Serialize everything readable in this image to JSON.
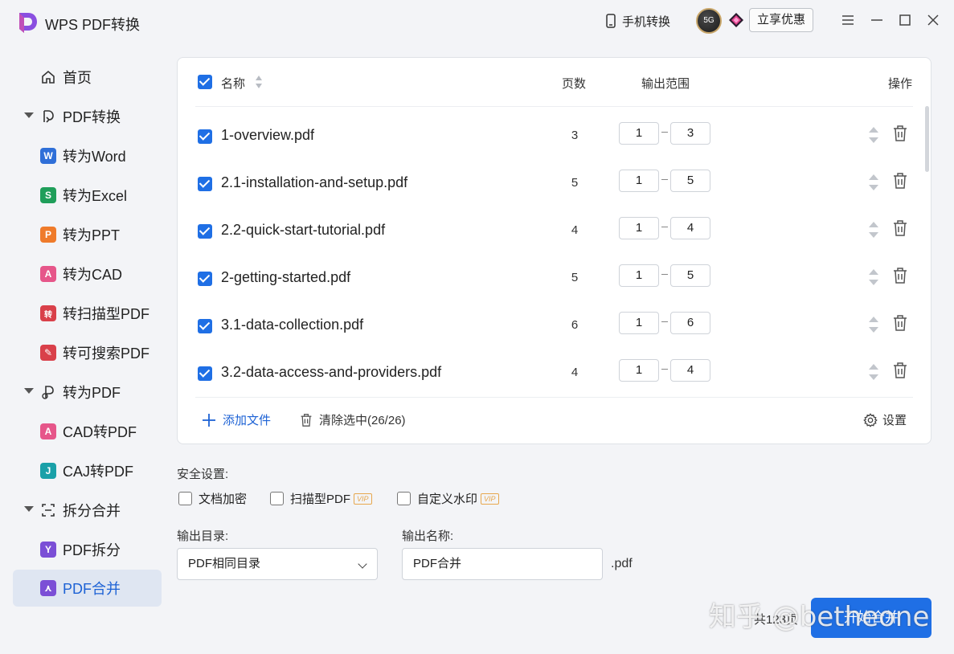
{
  "app": {
    "title": "WPS PDF转换",
    "brand_color": "#7b4fd6",
    "accent": "#1f6fe5"
  },
  "titlebar": {
    "phone_label": "手机转换",
    "avatar_text": "5G",
    "promo_label": "立享优惠"
  },
  "sidebar": {
    "items": [
      {
        "label": "首页",
        "icon": "home-icon"
      },
      {
        "label": "PDF转换",
        "icon": "pdf-convert-icon",
        "group": true
      },
      {
        "label": "转为Word",
        "icon": "word-icon",
        "badge": "W",
        "color": "#2f6fd8"
      },
      {
        "label": "转为Excel",
        "icon": "excel-icon",
        "badge": "S",
        "color": "#1f9e5a"
      },
      {
        "label": "转为PPT",
        "icon": "ppt-icon",
        "badge": "P",
        "color": "#ef7b2b"
      },
      {
        "label": "转为CAD",
        "icon": "cad-icon",
        "badge": "A",
        "color": "#e6568a"
      },
      {
        "label": "转扫描型PDF",
        "icon": "scan-pdf-icon",
        "badge": "转",
        "color": "#d9404a"
      },
      {
        "label": "转可搜索PDF",
        "icon": "searchable-pdf-icon",
        "badge": "✎",
        "color": "#d9404a"
      },
      {
        "label": "转为PDF",
        "icon": "to-pdf-icon",
        "group": true
      },
      {
        "label": "CAD转PDF",
        "icon": "cad-to-pdf-icon",
        "badge": "A",
        "color": "#e6568a"
      },
      {
        "label": "CAJ转PDF",
        "icon": "caj-to-pdf-icon",
        "badge": "J",
        "color": "#1aa0a8"
      },
      {
        "label": "拆分合并",
        "icon": "split-merge-icon",
        "group": true
      },
      {
        "label": "PDF拆分",
        "icon": "pdf-split-icon",
        "badge": "Y",
        "color": "#7b4fd6"
      },
      {
        "label": "PDF合并",
        "icon": "pdf-merge-icon",
        "badge": "⋏",
        "color": "#7b4fd6",
        "active": true
      }
    ]
  },
  "table": {
    "col_name": "名称",
    "col_pages": "页数",
    "col_range": "输出范围",
    "col_actions": "操作",
    "rows": [
      {
        "name": "1-overview.pdf",
        "pages": "3",
        "from": "1",
        "to": "3"
      },
      {
        "name": "2.1-installation-and-setup.pdf",
        "pages": "5",
        "from": "1",
        "to": "5"
      },
      {
        "name": "2.2-quick-start-tutorial.pdf",
        "pages": "4",
        "from": "1",
        "to": "4"
      },
      {
        "name": "2-getting-started.pdf",
        "pages": "5",
        "from": "1",
        "to": "5"
      },
      {
        "name": "3.1-data-collection.pdf",
        "pages": "6",
        "from": "1",
        "to": "6"
      },
      {
        "name": "3.2-data-access-and-providers.pdf",
        "pages": "4",
        "from": "1",
        "to": "4"
      }
    ],
    "add_file": "添加文件",
    "clear_selected": "清除选中(26/26)",
    "settings": "设置"
  },
  "security": {
    "label": "安全设置:",
    "options": [
      {
        "label": "文档加密",
        "vip": false
      },
      {
        "label": "扫描型PDF",
        "vip": true
      },
      {
        "label": "自定义水印",
        "vip": true
      }
    ],
    "vip_text": "VIP"
  },
  "output": {
    "dir_label": "输出目录:",
    "dir_value": "PDF相同目录",
    "name_label": "输出名称:",
    "name_value": "PDF合并",
    "ext": ".pdf"
  },
  "footer": {
    "total_pages": "共123页",
    "merge_button": "开始合并",
    "watermark": "知乎 @betheone"
  }
}
